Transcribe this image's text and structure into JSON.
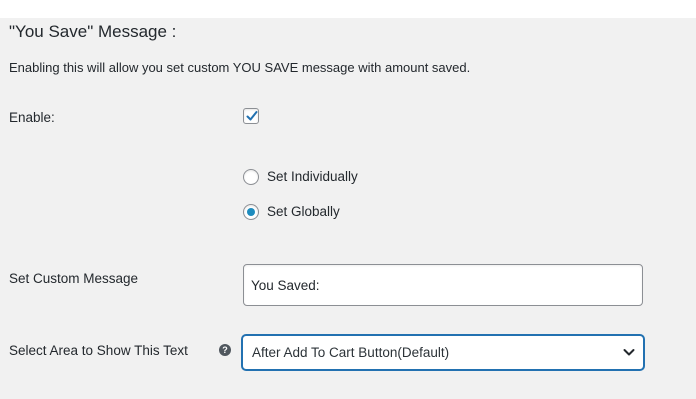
{
  "section": {
    "title": "\"You Save\" Message :",
    "description": "Enabling this will allow you set custom YOU SAVE message with amount saved."
  },
  "enable": {
    "label": "Enable:",
    "checked": true
  },
  "mode": {
    "options": [
      {
        "label": "Set Individually",
        "selected": false
      },
      {
        "label": "Set Globally",
        "selected": true
      }
    ]
  },
  "custom_message": {
    "label": "Set Custom Message",
    "value": "You Saved:"
  },
  "display_area": {
    "label": "Select Area to Show This Text",
    "help_icon": "question-circle-icon",
    "help_glyph": "?",
    "selected": "After Add To Cart Button(Default)"
  },
  "colors": {
    "accent": "#2271b1",
    "radio_dot": "#1e8cbe",
    "background": "#f1f1f1"
  }
}
